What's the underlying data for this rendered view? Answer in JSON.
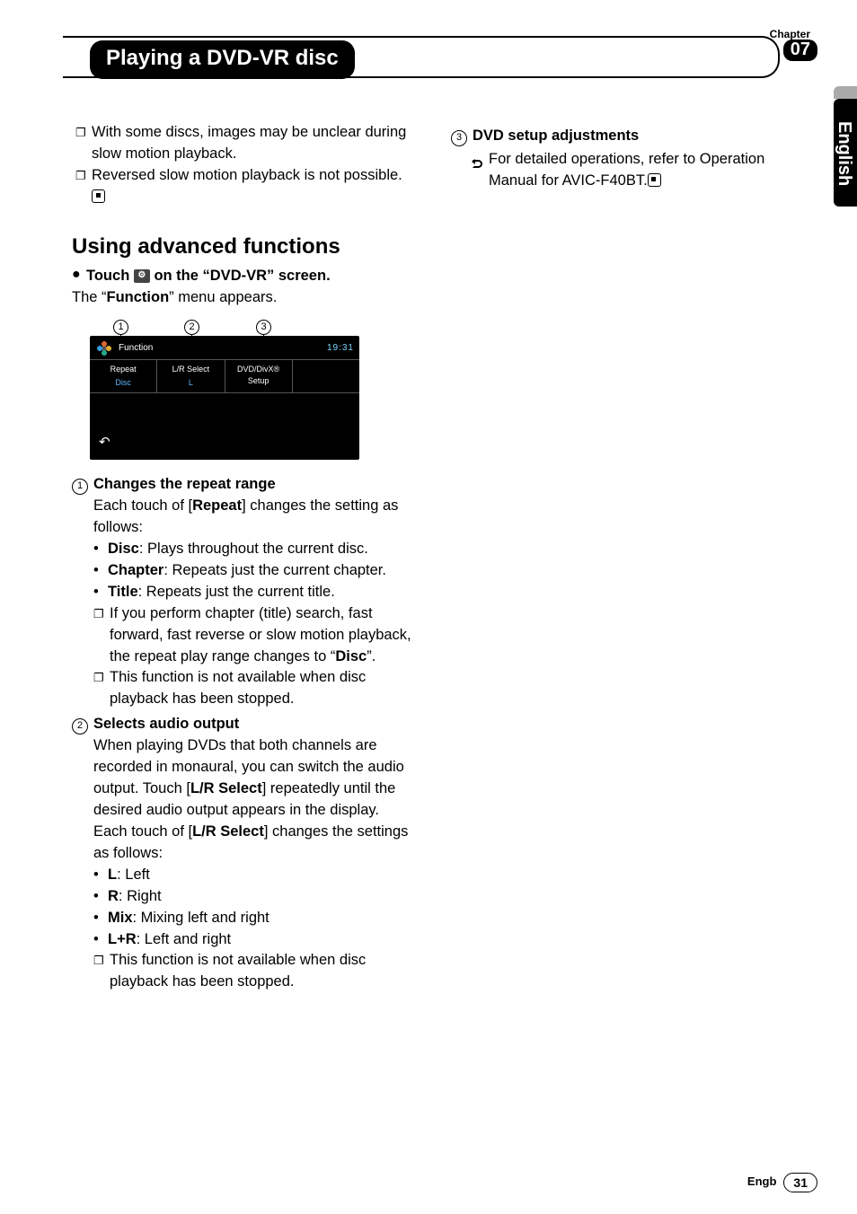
{
  "chapter": {
    "label": "Chapter",
    "number": "07"
  },
  "title": "Playing a DVD-VR disc",
  "languageTab": "English",
  "col1": {
    "notesTop": [
      "With some discs, images may be unclear during slow motion playback.",
      "Reversed slow motion playback is not possible."
    ],
    "heading": "Using advanced functions",
    "touchLine": {
      "pre": "Touch ",
      "post": " on the “DVD-VR” screen."
    },
    "funcLine": {
      "pre": "The “",
      "bold": "Function",
      "post": "” menu appears."
    },
    "figure": {
      "functionLabel": "Function",
      "time": "19:31",
      "tabs": [
        {
          "label": "Repeat",
          "value": "Disc"
        },
        {
          "label": "L/R Select",
          "value": "L"
        },
        {
          "label": "DVD/DivX®\nSetup",
          "value": ""
        }
      ]
    },
    "item1": {
      "head": "Changes the repeat range",
      "intro": {
        "pre": "Each touch of [",
        "bold": "Repeat",
        "post": "] changes the setting as follows:"
      },
      "opts": [
        {
          "b": "Disc",
          "t": ": Plays throughout the current disc."
        },
        {
          "b": "Chapter",
          "t": ": Repeats just the current chapter."
        },
        {
          "b": "Title",
          "t": ": Repeats just the current title."
        }
      ],
      "note1": {
        "pre": "If you perform chapter (title) search, fast forward, fast reverse or slow motion playback, the repeat play range changes to “",
        "bold": "Disc",
        "post": "”."
      },
      "note2": "This function is not available when disc playback has been stopped."
    },
    "item2": {
      "head": "Selects audio output",
      "para1": {
        "pre": "When playing DVDs that both channels are recorded in monaural, you can switch the audio output. Touch [",
        "bold": "L/R Select",
        "post": "] repeatedly until the desired audio output appears in the display."
      },
      "para2": {
        "pre": "Each touch of [",
        "bold": "L/R Select",
        "post": "] changes the settings as follows:"
      },
      "opts": [
        {
          "b": "L",
          "t": ": Left"
        },
        {
          "b": "R",
          "t": ": Right"
        },
        {
          "b": "Mix",
          "t": ": Mixing left and right"
        },
        {
          "b": "L+R",
          "t": ": Left and right"
        }
      ],
      "note": "This function is not available when disc playback has been stopped."
    }
  },
  "col2": {
    "item3": {
      "head": "DVD setup adjustments",
      "note": "For detailed operations, refer to Operation Manual for AVIC-F40BT."
    }
  },
  "footer": {
    "lang": "Engb",
    "page": "31"
  }
}
